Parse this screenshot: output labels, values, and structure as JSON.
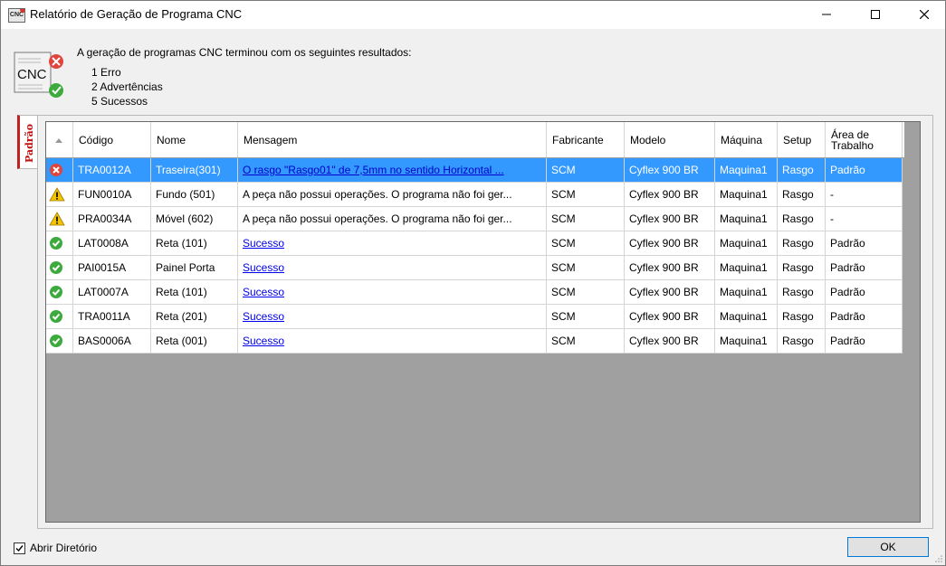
{
  "window": {
    "title": "Relatório de Geração de Programa CNC",
    "app_icon_text": "CNC"
  },
  "summary": {
    "icon_text": "CNC",
    "heading": "A geração de programas CNC terminou com os seguintes resultados:",
    "lines": [
      "1 Erro",
      "2 Advertências",
      "5 Sucessos"
    ]
  },
  "tab": {
    "label": "Padrão"
  },
  "grid": {
    "columns": [
      "",
      "Código",
      "Nome",
      "Mensagem",
      "Fabricante",
      "Modelo",
      "Máquina",
      "Setup",
      "Área de Trabalho"
    ],
    "rows": [
      {
        "status": "error",
        "codigo": "TRA0012A",
        "nome": "Traseira(301)",
        "mensagem": "O rasgo \"Rasgo01\" de 7,5mm no sentido Horizontal ...",
        "link": true,
        "fabricante": "SCM",
        "modelo": "Cyflex 900 BR",
        "maquina": "Maquina1",
        "setup": "Rasgo",
        "area": "Padrão",
        "selected": true
      },
      {
        "status": "warning",
        "codigo": "FUN0010A",
        "nome": "Fundo (501)",
        "mensagem": "A peça não possui operações. O programa não foi ger...",
        "link": false,
        "fabricante": "SCM",
        "modelo": "Cyflex 900 BR",
        "maquina": "Maquina1",
        "setup": "Rasgo",
        "area": "-",
        "selected": false
      },
      {
        "status": "warning",
        "codigo": "PRA0034A",
        "nome": "Móvel (602)",
        "mensagem": "A peça não possui operações. O programa não foi ger...",
        "link": false,
        "fabricante": "SCM",
        "modelo": "Cyflex 900 BR",
        "maquina": "Maquina1",
        "setup": "Rasgo",
        "area": "-",
        "selected": false
      },
      {
        "status": "success",
        "codigo": "LAT0008A",
        "nome": "Reta (101)",
        "mensagem": "Sucesso",
        "link": true,
        "fabricante": "SCM",
        "modelo": "Cyflex 900 BR",
        "maquina": "Maquina1",
        "setup": "Rasgo",
        "area": "Padrão",
        "selected": false
      },
      {
        "status": "success",
        "codigo": "PAI0015A",
        "nome": "Painel Porta",
        "mensagem": "Sucesso",
        "link": true,
        "fabricante": "SCM",
        "modelo": "Cyflex 900 BR",
        "maquina": "Maquina1",
        "setup": "Rasgo",
        "area": "Padrão",
        "selected": false
      },
      {
        "status": "success",
        "codigo": "LAT0007A",
        "nome": "Reta (101)",
        "mensagem": "Sucesso",
        "link": true,
        "fabricante": "SCM",
        "modelo": "Cyflex 900 BR",
        "maquina": "Maquina1",
        "setup": "Rasgo",
        "area": "Padrão",
        "selected": false
      },
      {
        "status": "success",
        "codigo": "TRA0011A",
        "nome": "Reta (201)",
        "mensagem": "Sucesso",
        "link": true,
        "fabricante": "SCM",
        "modelo": "Cyflex 900 BR",
        "maquina": "Maquina1",
        "setup": "Rasgo",
        "area": "Padrão",
        "selected": false
      },
      {
        "status": "success",
        "codigo": "BAS0006A",
        "nome": "Reta (001)",
        "mensagem": "Sucesso",
        "link": true,
        "fabricante": "SCM",
        "modelo": "Cyflex 900 BR",
        "maquina": "Maquina1",
        "setup": "Rasgo",
        "area": "Padrão",
        "selected": false
      }
    ]
  },
  "footer": {
    "checkbox_label": "Abrir Diretório",
    "checkbox_checked": true,
    "ok_label": "OK"
  },
  "colors": {
    "selection": "#3399ff",
    "error": "#e0443a",
    "warning": "#f5c400",
    "success": "#3daa3d",
    "grid_background": "#a0a0a0"
  }
}
